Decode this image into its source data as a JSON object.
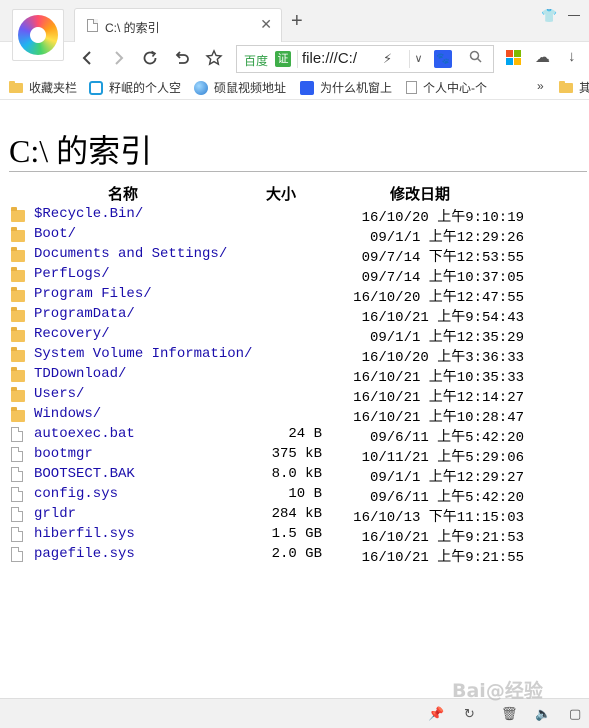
{
  "tab": {
    "title": "C:\\ 的索引"
  },
  "address_bar": {
    "engine_label": "百度",
    "cert_label": "证",
    "url": "file:///C:/"
  },
  "bookmarks": [
    {
      "label": "收藏夹栏"
    },
    {
      "label": "籽岷的个人空"
    },
    {
      "label": "硕鼠视频地址"
    },
    {
      "label": "为什么机窗上"
    },
    {
      "label": "个人中心-个"
    }
  ],
  "bookmarks_more": "»",
  "bookmarks_overflow_label": "其",
  "page": {
    "heading": "C:\\ 的索引",
    "columns": {
      "name": "名称",
      "size": "大小",
      "modified": "修改日期"
    },
    "entries": [
      {
        "type": "folder",
        "name": "$Recycle.Bin/",
        "size": "",
        "date": "16/10/20 上午9:10:19"
      },
      {
        "type": "folder",
        "name": "Boot/",
        "size": "",
        "date": "09/1/1 上午12:29:26"
      },
      {
        "type": "folder",
        "name": "Documents and Settings/",
        "size": "",
        "date": "09/7/14 下午12:53:55"
      },
      {
        "type": "folder",
        "name": "PerfLogs/",
        "size": "",
        "date": "09/7/14 上午10:37:05"
      },
      {
        "type": "folder",
        "name": "Program Files/",
        "size": "",
        "date": "16/10/20 上午12:47:55"
      },
      {
        "type": "folder",
        "name": "ProgramData/",
        "size": "",
        "date": "16/10/21 上午9:54:43"
      },
      {
        "type": "folder",
        "name": "Recovery/",
        "size": "",
        "date": "09/1/1 上午12:35:29"
      },
      {
        "type": "folder",
        "name": "System Volume Information/",
        "size": "",
        "date": "16/10/20 上午3:36:33"
      },
      {
        "type": "folder",
        "name": "TDDownload/",
        "size": "",
        "date": "16/10/21 上午10:35:33"
      },
      {
        "type": "folder",
        "name": "Users/",
        "size": "",
        "date": "16/10/21 上午12:14:27"
      },
      {
        "type": "folder",
        "name": "Windows/",
        "size": "",
        "date": "16/10/21 上午10:28:47"
      },
      {
        "type": "file",
        "name": "autoexec.bat",
        "size": "24 B",
        "date": "09/6/11 上午5:42:20"
      },
      {
        "type": "file",
        "name": "bootmgr",
        "size": "375 kB",
        "date": "10/11/21 上午5:29:06"
      },
      {
        "type": "file",
        "name": "BOOTSECT.BAK",
        "size": "8.0 kB",
        "date": "09/1/1 上午12:29:27"
      },
      {
        "type": "file",
        "name": "config.sys",
        "size": "10 B",
        "date": "09/6/11 上午5:42:20"
      },
      {
        "type": "file",
        "name": "grldr",
        "size": "284 kB",
        "date": "16/10/13 下午11:15:03"
      },
      {
        "type": "file",
        "name": "hiberfil.sys",
        "size": "1.5 GB",
        "date": "16/10/21 上午9:21:53"
      },
      {
        "type": "file",
        "name": "pagefile.sys",
        "size": "2.0 GB",
        "date": "16/10/21 上午9:21:55"
      }
    ]
  },
  "watermark": "Bai@经验",
  "colors": {
    "link": "#1a0dab",
    "folder": "#f4c35a",
    "cert_green": "#3fae49",
    "baidu_blue": "#2d5ef0"
  },
  "icons": {
    "toolbar": [
      "back-icon",
      "forward-icon",
      "refresh-icon",
      "undo-icon",
      "star-icon"
    ],
    "statusbar": [
      "pin-icon",
      "speedup-icon",
      "trash-icon",
      "volume-icon",
      "window-icon"
    ]
  }
}
